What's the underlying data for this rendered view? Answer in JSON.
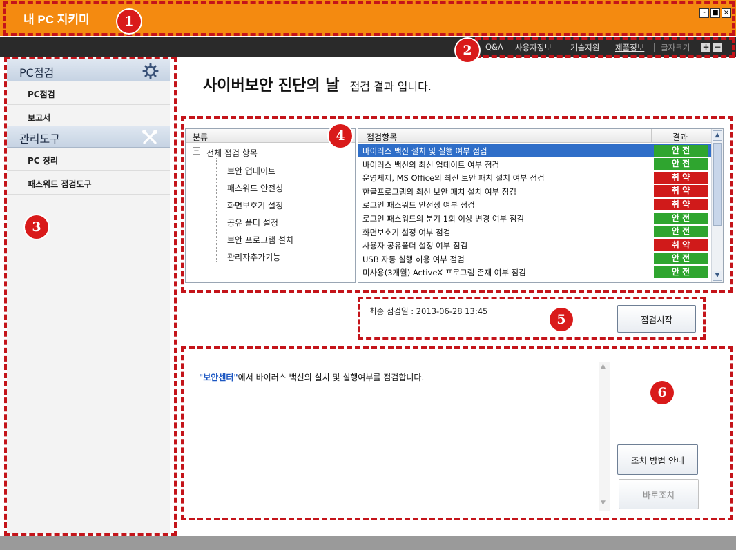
{
  "app": {
    "title": "내 PC 지키미"
  },
  "window_controls": {
    "minimize": "-",
    "maximize": "■",
    "close": "×"
  },
  "topnav": {
    "items": [
      "Q&A",
      "사용자정보",
      "기술지원",
      "제품정보"
    ],
    "font_size_label": "글자크기",
    "plus": "+",
    "minus": "−"
  },
  "sidebar": {
    "section1": {
      "title": "PC점검",
      "items": [
        "PC점검",
        "보고서"
      ]
    },
    "section2": {
      "title": "관리도구",
      "items": [
        "PC 정리",
        "패스워드 점검도구"
      ]
    }
  },
  "main": {
    "heading_big": "사이버보안 진단의 날",
    "heading_small": "점검 결과 입니다."
  },
  "tree": {
    "header": "분류",
    "root": "전체 점검 항목",
    "expander": "−",
    "children": [
      "보안 업데이트",
      "패스워드 안전성",
      "화면보호기 설정",
      "공유 폴더 설정",
      "보안 프로그램 설치",
      "관리자추가기능"
    ]
  },
  "results": {
    "header_item": "점검항목",
    "header_result": "결과",
    "rows": [
      {
        "item": "바이러스 백신 설치 및 실행 여부 점검",
        "result": "안 전",
        "status": "safe",
        "selected": true
      },
      {
        "item": "바이러스 백신의 최신 업데이트 여부 점검",
        "result": "안 전",
        "status": "safe"
      },
      {
        "item": "운영체제, MS Office의 최신 보안 패치 설치 여부 점검",
        "result": "취 약",
        "status": "weak"
      },
      {
        "item": "한글프로그램의 최신 보안 패치 설치 여부 점검",
        "result": "취 약",
        "status": "weak"
      },
      {
        "item": "로그인 패스워드 안전성 여부 점검",
        "result": "취 약",
        "status": "weak"
      },
      {
        "item": "로그인 패스워드의 분기 1회 이상 변경 여부 점검",
        "result": "안 전",
        "status": "safe"
      },
      {
        "item": "화면보호기 설정 여부 점검",
        "result": "안 전",
        "status": "safe"
      },
      {
        "item": "사용자 공유폴더 설정 여부 점검",
        "result": "취 약",
        "status": "weak"
      },
      {
        "item": "USB 자동 실행 허용 여부 점검",
        "result": "안 전",
        "status": "safe"
      },
      {
        "item": "미사용(3개월) ActiveX 프로그램 존재 여부 점검",
        "result": "안 전",
        "status": "safe"
      }
    ],
    "scroll_up": "▲",
    "scroll_down": "▼"
  },
  "status": {
    "last_check": "최종 점검일 : 2013-06-28 13:45",
    "start_button": "점검시작"
  },
  "description": {
    "highlight": "\"보안센터\"",
    "text": "에서 바이러스 백신의 설치 및 실행여부를 점검합니다.",
    "guide_button": "조치 방법 안내",
    "fix_button": "바로조치",
    "scroll_up": "▲",
    "scroll_down": "▼"
  },
  "markers": [
    "1",
    "2",
    "3",
    "4",
    "5",
    "6"
  ],
  "colors": {
    "titlebar": "#f48a10",
    "safe": "#2fa52f",
    "weak": "#d01a1a",
    "selected_row": "#2f6ec8",
    "annotation": "#c4141a"
  }
}
